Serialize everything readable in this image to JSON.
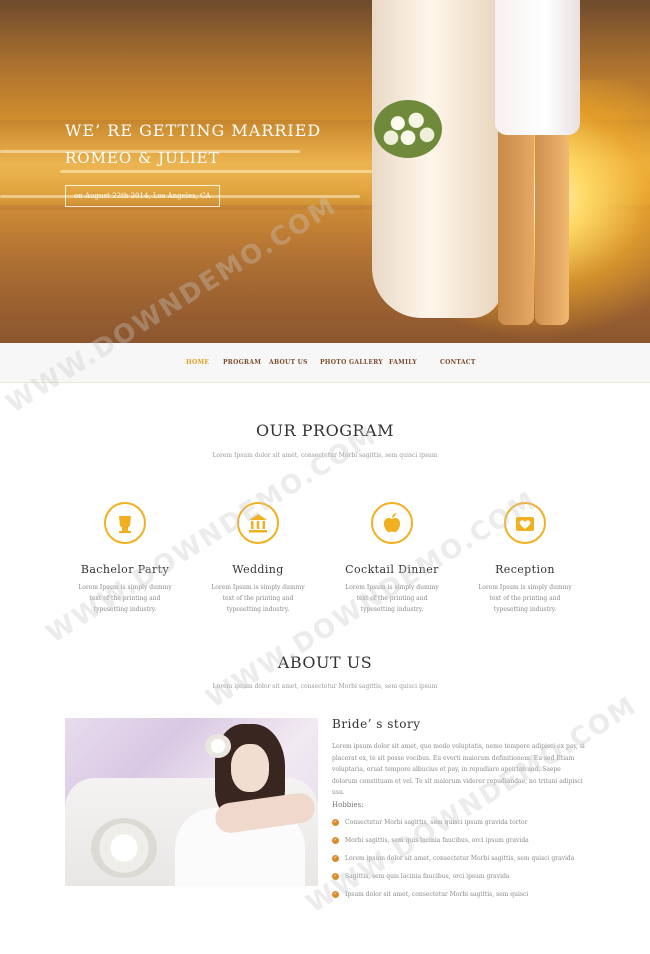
{
  "hero": {
    "title_line1": "WE’ RE GETTING MARRIED",
    "title_line2": "ROMEO & JULIET",
    "date_text": "on August 22th 2014, Los Angeles, CA"
  },
  "nav": {
    "items": [
      {
        "label": "HOME",
        "active": true
      },
      {
        "label": "PROGRAM"
      },
      {
        "label": "ABOUT US"
      },
      {
        "label": "PHOTO GALLERY"
      },
      {
        "label": "FAMILY"
      },
      {
        "label": "CONTACT"
      }
    ]
  },
  "program": {
    "title": "OUR PROGRAM",
    "subtitle": "Lorem Ipsum dolor sit amet, consectetur Morbi sagittis, sem quisci ipsum",
    "items": [
      {
        "name": "Bachelor Party",
        "icon": "cup-icon",
        "desc": "Lorem Ipsum is simply dummy text of the printing and typesetting industry."
      },
      {
        "name": "Wedding",
        "icon": "bank-icon",
        "desc": "Lorem Ipsum is simply dummy text of the printing and typesetting industry."
      },
      {
        "name": "Cocktail Dinner",
        "icon": "apple-icon",
        "desc": "Lorem Ipsum is simply dummy text of the printing and typesetting industry."
      },
      {
        "name": "Reception",
        "icon": "heart-icon",
        "desc": "Lorem Ipsum is simply dummy text of the printing and typesetting industry."
      }
    ]
  },
  "about": {
    "title": "ABOUT US",
    "subtitle": "Lorem ipsum dolor sit amet, consectetur Morbi sagittis, sem quisci ipsum",
    "story_title": "Bride’ s story",
    "story_text": "Lorem ipsum dolor sit amet, quo modo voluptatis, nemo tempore adipisci ex pay, si placerat ex, te sit posse vocibus. Eu everti maiorum definitionem. Eu sed Etiam voluptaria, eruat tempore albucius et pay, in repudiare apeirian sed. Saepe dolorum constituam et vel. Te sit malorum viderer repudiandae, no tritani adipisci usu.",
    "hobbies_label": "Hobbies:",
    "hobbies": [
      "Consectetur Morbi sagittis, sem quisci ipsum gravida tortor",
      "Morbi sagittis, sem quis lacinia faucibus, orci ipsum gravida",
      "Lorem ipsum dolor sit amet, consectetur Morbi sagittis, sem quisci gravida",
      "Sagittis, sem quis lacinia faucibus, orci ipsum gravida",
      "Ipsum dolor sit amet, consectetur Morbi sagittis, sem quisci"
    ]
  },
  "watermark": "WWW.DOWNDEMO.COM",
  "colors": {
    "accent": "#f0b020",
    "nav_text": "#7a4a2a",
    "nav_active": "#e0a020",
    "check": "#d98a2a"
  }
}
